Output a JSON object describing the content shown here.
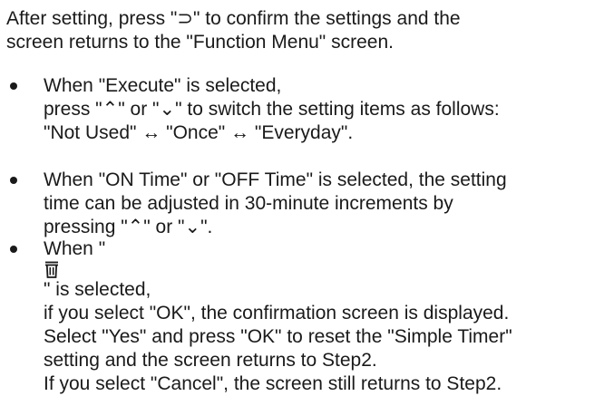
{
  "intro": {
    "lines": [
      "After setting, press \"⊃\" to confirm the settings and the",
      "screen returns to the \"Function Menu\" screen."
    ]
  },
  "bullets": [
    {
      "lines": [
        "When \"Execute\" is selected,",
        "press \"⌃\" or \"⌄\" to switch the setting items as follows:",
        "\"Not Used\" ↔ \"Once\" ↔ \"Everyday\"."
      ]
    },
    {
      "lines": [
        "When \"ON Time\" or \"OFF Time\" is selected, the setting",
        "time can be adjusted in 30-minute increments by",
        "pressing \"⌃\" or \"⌄\"."
      ]
    },
    {
      "line1_before_icon": "When \"",
      "line1_after_icon": "\" is selected,",
      "icon": "trash-icon",
      "lines": [
        "if you select \"OK\", the confirmation screen is displayed.",
        "Select \"Yes\" and press \"OK\" to reset the \"Simple Timer\"",
        "setting and the screen returns to Step2.",
        "If you select \"Cancel\", the screen still returns to Step2."
      ]
    }
  ]
}
